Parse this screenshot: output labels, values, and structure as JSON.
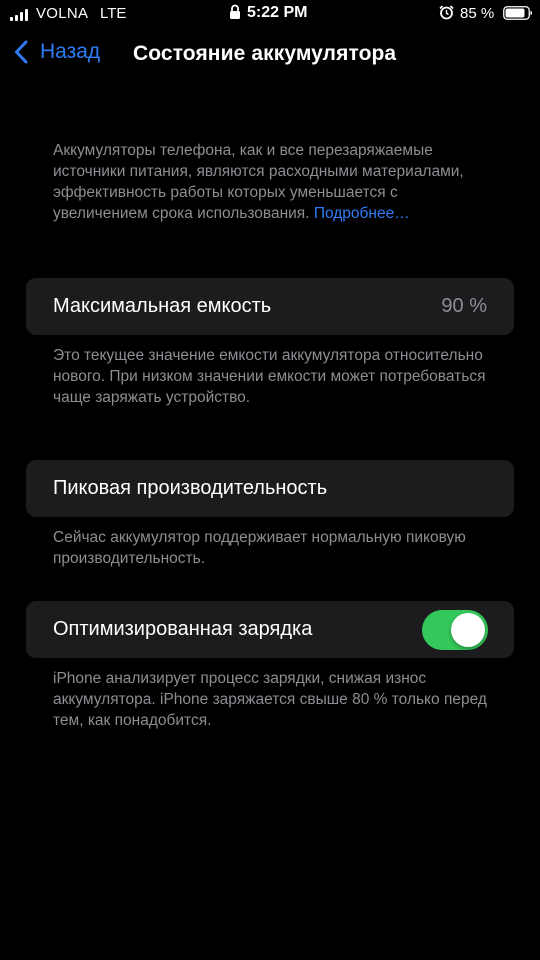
{
  "status_bar": {
    "carrier": "VOLNA",
    "network": "LTE",
    "time": "5:22 PM",
    "battery_percent": "85 %"
  },
  "nav": {
    "back_label": "Назад",
    "title": "Состояние аккумулятора"
  },
  "intro": {
    "text": "Аккумуляторы телефона, как и все перезаряжаемые источники питания, являются расходными материалами, эффективность работы которых уменьшается с увеличением срока использования.",
    "link": "Подробнее…"
  },
  "max_capacity": {
    "label": "Максимальная емкость",
    "value": "90 %",
    "description": "Это текущее значение емкости аккумулятора относительно нового. При низком значении емкости может потребоваться чаще заряжать устройство."
  },
  "peak_performance": {
    "label": "Пиковая производительность",
    "description": "Сейчас аккумулятор поддерживает нормальную пиковую производительность."
  },
  "optimized_charging": {
    "label": "Оптимизированная зарядка",
    "enabled": true,
    "description": "iPhone анализирует процесс зарядки, снижая износ аккумулятора. iPhone заряжается свыше 80 % только перед тем, как понадобится."
  },
  "colors": {
    "background": "#000000",
    "cell_background": "#1c1c1e",
    "accent_blue": "#2f7cf6",
    "toggle_green": "#34c759",
    "secondary_text": "#8d8d93"
  }
}
